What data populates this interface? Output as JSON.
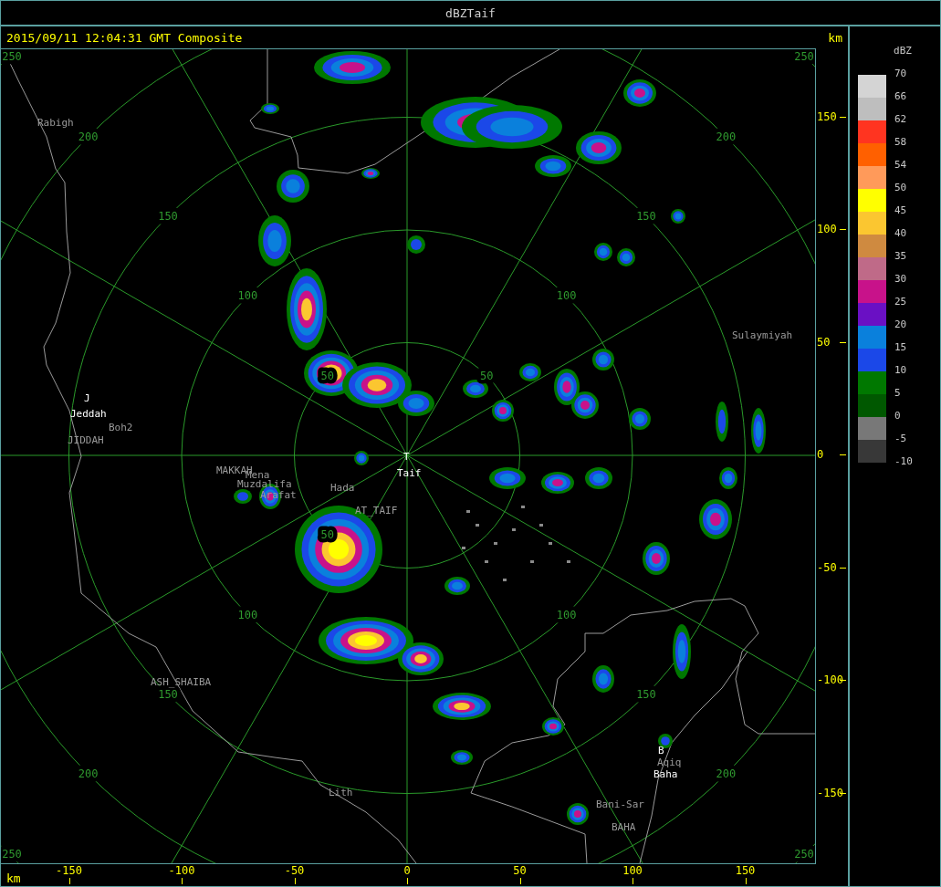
{
  "window": {
    "title": "dBZTaif"
  },
  "header": {
    "timestamp": "2015/09/11 12:04:31 GMT Composite",
    "unit": "km"
  },
  "map": {
    "range_rings": [
      {
        "labels": [
          "50",
          "50",
          "50"
        ]
      },
      {
        "labels": [
          "100",
          "100",
          "100",
          "100"
        ]
      },
      {
        "labels": [
          "150",
          "150",
          "150",
          "150"
        ]
      },
      {
        "labels": [
          "200",
          "200",
          "200",
          "200"
        ]
      },
      {
        "labels": [
          "250",
          "250",
          "250",
          "250"
        ]
      }
    ],
    "places": [
      {
        "text": "Rabigh",
        "kind": "place"
      },
      {
        "text": "J",
        "kind": "station"
      },
      {
        "text": "Jeddah",
        "kind": "station"
      },
      {
        "text": "Boh2",
        "kind": "place"
      },
      {
        "text": "JIDDAH",
        "kind": "place"
      },
      {
        "text": "MAKKAH",
        "kind": "place"
      },
      {
        "text": "Mena",
        "kind": "place"
      },
      {
        "text": "Muzdalifa",
        "kind": "place"
      },
      {
        "text": "Arafat",
        "kind": "place"
      },
      {
        "text": "Hada",
        "kind": "place"
      },
      {
        "text": "AT_TAIF",
        "kind": "place"
      },
      {
        "text": "T",
        "kind": "station"
      },
      {
        "text": "Taif",
        "kind": "station"
      },
      {
        "text": "Sulaymiyah",
        "kind": "place"
      },
      {
        "text": "ASH_SHAIBA",
        "kind": "place"
      },
      {
        "text": "Lith",
        "kind": "place"
      },
      {
        "text": "B",
        "kind": "station"
      },
      {
        "text": "Aqiq",
        "kind": "place"
      },
      {
        "text": "Baha",
        "kind": "station"
      },
      {
        "text": "Bani-Sar",
        "kind": "place"
      },
      {
        "text": "BAHA",
        "kind": "place"
      }
    ]
  },
  "y_axis": {
    "ticks": [
      "150",
      "100",
      "50",
      "0",
      "-50",
      "-100",
      "-150"
    ]
  },
  "x_axis": {
    "unit": "km",
    "ticks": [
      "-150",
      "-100",
      "-50",
      "0",
      "50",
      "100",
      "150"
    ]
  },
  "legend": {
    "title": "dBZ",
    "bins": [
      {
        "color": "#d4d4d4"
      },
      {
        "color": "#bebebe"
      },
      {
        "color": "#ff3420"
      },
      {
        "color": "#ff6000"
      },
      {
        "color": "#ff9a5a"
      },
      {
        "color": "#ffff00"
      },
      {
        "color": "#fbc630"
      },
      {
        "color": "#cf8a40"
      },
      {
        "color": "#bf6a88"
      },
      {
        "color": "#c8128a"
      },
      {
        "color": "#6a10c4"
      },
      {
        "color": "#0a80dc"
      },
      {
        "color": "#1b48e8"
      },
      {
        "color": "#007800"
      },
      {
        "color": "#005800"
      },
      {
        "color": "#787878"
      },
      {
        "color": "#383838"
      }
    ],
    "labels": [
      "70",
      "66",
      "62",
      "58",
      "54",
      "50",
      "45",
      "40",
      "35",
      "30",
      "25",
      "20",
      "15",
      "10",
      "5",
      "0",
      "-5",
      "-10"
    ]
  }
}
